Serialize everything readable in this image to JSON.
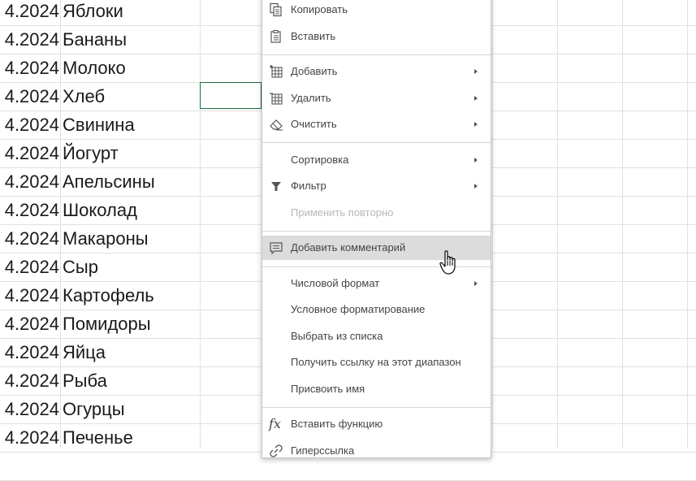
{
  "sheet": {
    "rows": [
      {
        "date": "4.2024",
        "product": "Яблоки"
      },
      {
        "date": "4.2024",
        "product": "Бананы"
      },
      {
        "date": "4.2024",
        "product": "Молоко"
      },
      {
        "date": "4.2024",
        "product": "Хлеб"
      },
      {
        "date": "4.2024",
        "product": "Свинина"
      },
      {
        "date": "4.2024",
        "product": "Йогурт"
      },
      {
        "date": "4.2024",
        "product": "Апельсины"
      },
      {
        "date": "4.2024",
        "product": "Шоколад"
      },
      {
        "date": "4.2024",
        "product": "Макароны"
      },
      {
        "date": "4.2024",
        "product": "Сыр"
      },
      {
        "date": "4.2024",
        "product": "Картофель"
      },
      {
        "date": "4.2024",
        "product": "Помидоры"
      },
      {
        "date": "4.2024",
        "product": "Яйца"
      },
      {
        "date": "4.2024",
        "product": "Рыба"
      },
      {
        "date": "4.2024",
        "product": "Огурцы"
      },
      {
        "date": "4.2024",
        "product": "Печенье"
      }
    ],
    "selection_color": "#1e6b3d",
    "grid_color": "#e1e1e1"
  },
  "context_menu": {
    "items": [
      {
        "label": "Копировать",
        "icon": "copy-icon"
      },
      {
        "label": "Вставить",
        "icon": "paste-icon"
      },
      {
        "label": "Добавить",
        "icon": "insert-cells-icon",
        "submenu": true
      },
      {
        "label": "Удалить",
        "icon": "delete-cells-icon",
        "submenu": true
      },
      {
        "label": "Очистить",
        "icon": "eraser-icon",
        "submenu": true
      },
      {
        "label": "Сортировка",
        "submenu": true
      },
      {
        "label": "Фильтр",
        "icon": "filter-icon",
        "submenu": true
      },
      {
        "label": "Применить повторно",
        "disabled": true
      },
      {
        "label": "Добавить комментарий",
        "icon": "comment-icon",
        "hovered": true
      },
      {
        "label": "Числовой формат",
        "submenu": true
      },
      {
        "label": "Условное форматирование"
      },
      {
        "label": "Выбрать из списка"
      },
      {
        "label": "Получить ссылку на этот диапазон"
      },
      {
        "label": "Присвоить имя"
      },
      {
        "label": "Вставить функцию",
        "icon": "function-icon"
      },
      {
        "label": "Гиперссылка",
        "icon": "hyperlink-icon"
      }
    ],
    "hover_color": "#dcdcdc"
  }
}
